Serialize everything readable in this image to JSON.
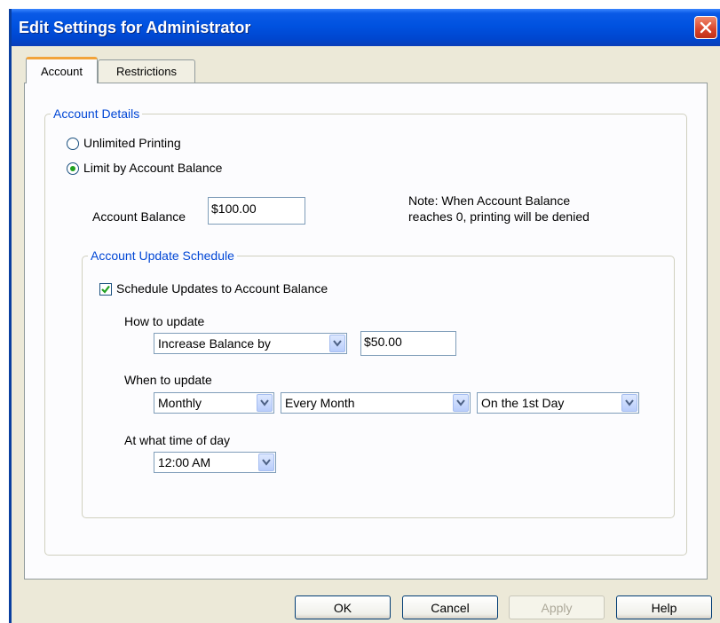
{
  "window": {
    "title": "Edit Settings for Administrator"
  },
  "tabs": [
    {
      "label": "Account",
      "active": true
    },
    {
      "label": "Restrictions",
      "active": false
    }
  ],
  "account_details": {
    "legend": "Account Details",
    "radio_unlimited": {
      "label": "Unlimited Printing",
      "selected": false
    },
    "radio_limit": {
      "label": "Limit by Account Balance",
      "selected": true
    },
    "balance_label": "Account Balance",
    "balance_value": "$100.00",
    "note_line1": "Note: When Account Balance",
    "note_line2": "reaches 0, printing will be denied"
  },
  "schedule": {
    "legend": "Account Update Schedule",
    "checkbox_label": "Schedule Updates to Account Balance",
    "checked": true,
    "how_label": "How to update",
    "how_select": "Increase Balance by",
    "how_amount": "$50.00",
    "when_label": "When to update",
    "when_frequency": "Monthly",
    "when_interval": "Every Month",
    "when_day": "On the 1st Day",
    "time_label": "At what time of day",
    "time_value": "12:00 AM"
  },
  "buttons": {
    "ok": "OK",
    "cancel": "Cancel",
    "apply": "Apply",
    "help": "Help"
  },
  "colors": {
    "title_bar": "#0052e0",
    "group_legend": "#0046d5",
    "active_tab_accent": "#f2a33a",
    "radio_dot": "#21a121",
    "checkmark": "#21a121"
  }
}
